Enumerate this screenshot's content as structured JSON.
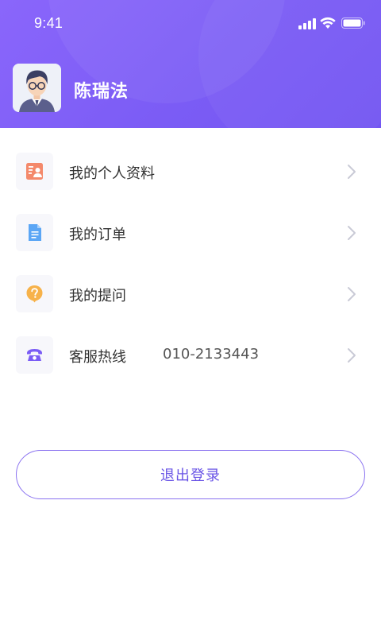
{
  "status_bar": {
    "time": "9:41",
    "icons": [
      "signal-icon",
      "wifi-icon",
      "battery-icon"
    ]
  },
  "profile": {
    "name": "陈瑞法",
    "avatar_icon": "avatar-icon"
  },
  "menu": {
    "items": [
      {
        "label": "我的个人资料",
        "icon": "profile-card-icon",
        "icon_color": "#f4896b"
      },
      {
        "label": "我的订单",
        "icon": "document-icon",
        "icon_color": "#5ba6f5"
      },
      {
        "label": "我的提问",
        "icon": "question-icon",
        "icon_color": "#f7b24a"
      },
      {
        "label": "客服热线",
        "value": "010-2133443",
        "icon": "telephone-icon",
        "icon_color": "#7a5cf5"
      }
    ]
  },
  "logout": {
    "label": "退出登录"
  },
  "colors": {
    "header_gradient_start": "#8a66fb",
    "header_gradient_end": "#7356f2",
    "accent": "#6a55e6"
  }
}
